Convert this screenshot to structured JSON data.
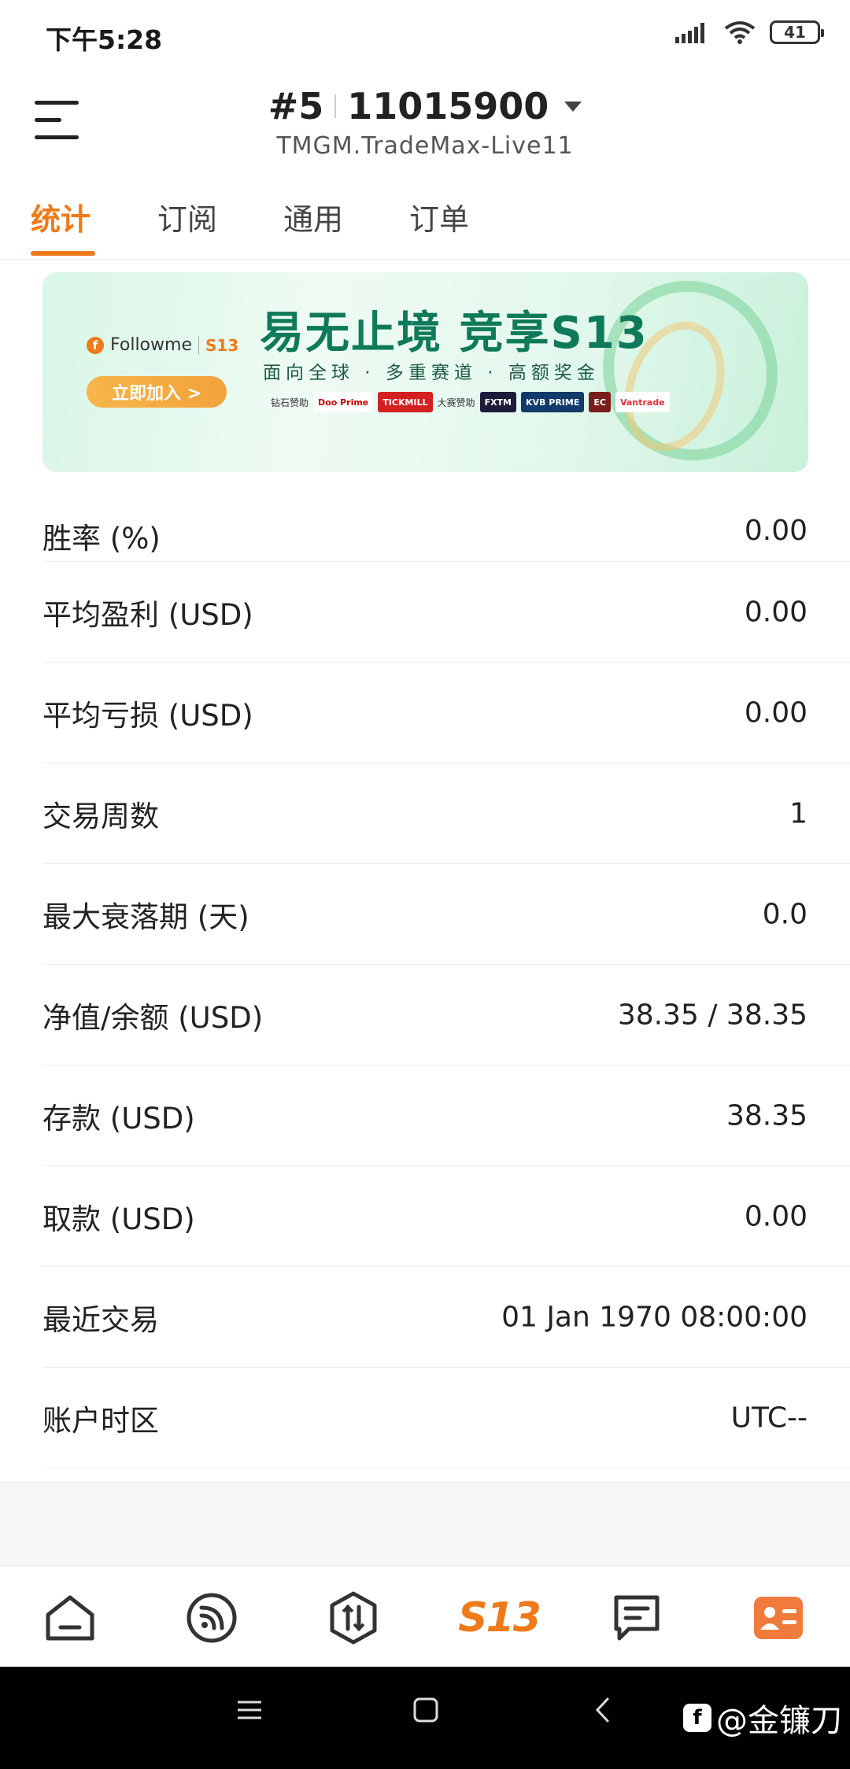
{
  "status_bar": {
    "time": "下午5:28",
    "battery": "41"
  },
  "header": {
    "account_index": "#5",
    "account_number": "11015900",
    "server": "TMGM.TradeMax-Live11"
  },
  "tabs": [
    {
      "label": "统计",
      "active": true
    },
    {
      "label": "订阅",
      "active": false
    },
    {
      "label": "通用",
      "active": false
    },
    {
      "label": "订单",
      "active": false
    }
  ],
  "banner": {
    "brand": "Followme",
    "brand_badge": "S13",
    "cta": "立即加入 >",
    "headline": "易无止境 竞享S13",
    "subline": "面向全球 · 多重赛道 · 高额奖金",
    "diamond_label": "钻石赞助",
    "grand_label": "大赛赞助",
    "sponsors": [
      "Doo Prime",
      "TICKMILL",
      "FXTM",
      "KVB PRIME",
      "EC",
      "Vantrade"
    ]
  },
  "stats": [
    {
      "label": "胜率 (%)",
      "value": "0.00"
    },
    {
      "label": "平均盈利 (USD)",
      "value": "0.00"
    },
    {
      "label": "平均亏损 (USD)",
      "value": "0.00"
    },
    {
      "label": "交易周数",
      "value": "1"
    },
    {
      "label": "最大衰落期 (天)",
      "value": "0.0"
    },
    {
      "label": "净值/余额 (USD)",
      "value": "38.35 / 38.35"
    },
    {
      "label": "存款 (USD)",
      "value": "38.35"
    },
    {
      "label": "取款 (USD)",
      "value": "0.00"
    },
    {
      "label": "最近交易",
      "value": "01 Jan 1970 08:00:00"
    },
    {
      "label": "账户时区",
      "value": "UTC--"
    }
  ],
  "bottom_nav": {
    "s13_label": "S13"
  },
  "watermark": {
    "logo": "f",
    "text": "@金镰刀"
  },
  "colors": {
    "accent": "#ef7a1a",
    "banner_headline": "#0f7a5a"
  }
}
